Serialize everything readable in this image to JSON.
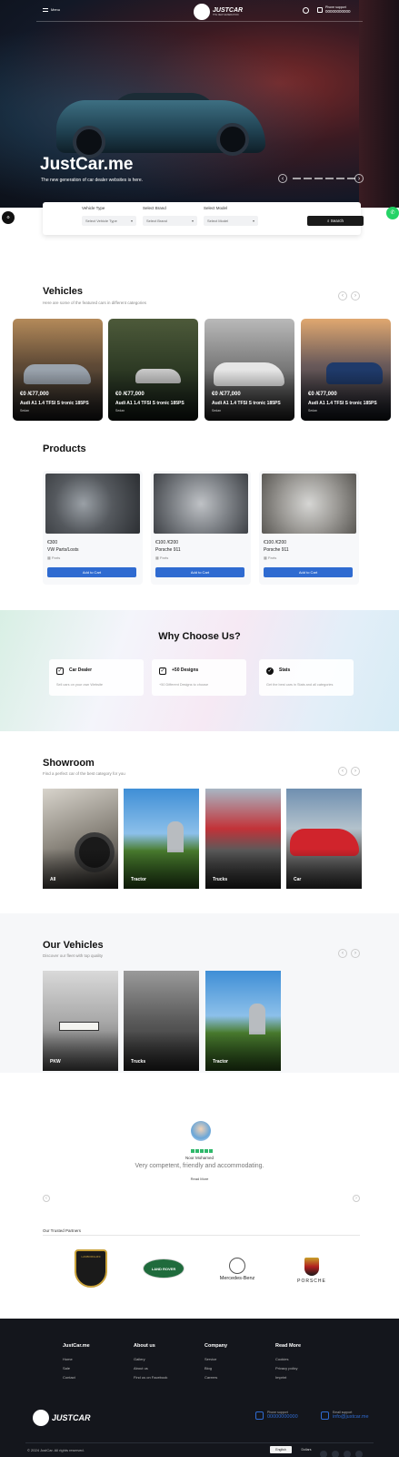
{
  "header": {
    "menu_label": "Menu",
    "brand_name": "JUSTCAR",
    "brand_tagline": "THE NEW GENERATION",
    "phone_label": "Phone support",
    "phone_number": "00000000000"
  },
  "hero": {
    "title": "JustCar.me",
    "subtitle": "The new generation of car dealer websites is here."
  },
  "search": {
    "fields": [
      {
        "label": "Vehicle Type",
        "value": "Select Vehicle Type"
      },
      {
        "label": "Select Brand",
        "value": "Select Brand"
      },
      {
        "label": "Select Model",
        "value": "Select Model"
      }
    ],
    "button": "Search"
  },
  "vehicles": {
    "title": "Vehicles",
    "subtitle": "Here are some of the featured cars in different categories",
    "items": [
      {
        "price": "€0 /€77,000",
        "name": "Audi A1 1.4 TFSI S tronic 185PS",
        "meta": "Sedan"
      },
      {
        "price": "€0 /€77,000",
        "name": "Audi A1 1.4 TFSI S tronic 185PS",
        "meta": "Sedan"
      },
      {
        "price": "€0 /€77,000",
        "name": "Audi A1 1.4 TFSI S tronic 185PS",
        "meta": "Sedan"
      },
      {
        "price": "€0 /€77,000",
        "name": "Audi A1 1.4 TFSI S tronic 185PS",
        "meta": "Sedan"
      }
    ]
  },
  "products": {
    "title": "Products",
    "items": [
      {
        "price": "€300",
        "name": "VW Parts/Losts",
        "meta": "Parts",
        "button": "Add to Cart"
      },
      {
        "price": "€100 /€200",
        "name": "Porsche 911",
        "meta": "Parts",
        "button": "Add to Cart"
      },
      {
        "price": "€100 /€200",
        "name": "Porsche 911",
        "meta": "Parts",
        "button": "Add to Cart"
      }
    ]
  },
  "why": {
    "title": "Why Choose Us?",
    "items": [
      {
        "title": "Car Dealer",
        "desc": "Sell cars on your own Website",
        "icon": "check-icon"
      },
      {
        "title": "+50 Designs",
        "desc": "+50 Different Designs to choose",
        "icon": "check-square-icon"
      },
      {
        "title": "Stats",
        "desc": "Get the best cars in Stats and all categories",
        "icon": "check-circle-icon"
      }
    ]
  },
  "showroom": {
    "title": "Showroom",
    "subtitle": "Find a perfect car of the best category for you",
    "items": [
      "All",
      "Tractor",
      "Trucks",
      "Car"
    ]
  },
  "our_vehicles": {
    "title": "Our Vehicles",
    "subtitle": "Discover our fleet with top quality",
    "items": [
      "PKW",
      "Trucks",
      "Tractor"
    ]
  },
  "testimonial": {
    "name": "Noor Mohamed",
    "quote": "Very competent, friendly and accommodating.",
    "link": "Read More"
  },
  "brands": {
    "title": "Our Trusted Partners",
    "items": [
      "LAMBORGHINI",
      "LAND ROVER",
      "Mercedes-Benz",
      "PORSCHE"
    ]
  },
  "footer": {
    "columns": [
      {
        "title": "JustCar.me",
        "links": [
          "Home",
          "Sale",
          "Contact"
        ]
      },
      {
        "title": "About us",
        "links": [
          "Gallery",
          "About us",
          "Find us on Facebook"
        ]
      },
      {
        "title": "Company",
        "links": [
          "Service",
          "Blog",
          "Careers"
        ]
      },
      {
        "title": "Read More",
        "links": [
          "Cookies",
          "Privacy policy",
          "Imprint"
        ]
      }
    ],
    "brand_name": "JUSTCAR",
    "phone_label": "Phone support",
    "phone_number": "00000000000",
    "email_label": "Email support",
    "email": "info@justcar.me",
    "copyright": "© 2024 JustCar. All rights reserved.",
    "lang_label": "English",
    "currency_label": "Dollars"
  },
  "colors": {
    "accent_blue": "#2f6bd1",
    "footer_bg": "#14161c",
    "star_green": "#2fb86a",
    "whatsapp_green": "#25d366"
  }
}
